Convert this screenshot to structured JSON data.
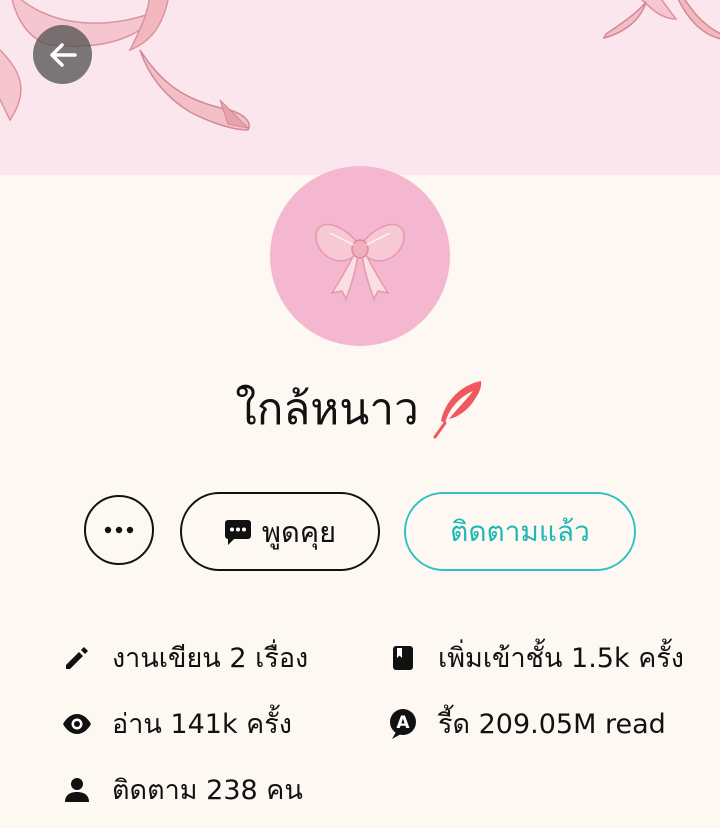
{
  "profile": {
    "name": "ใกล้หนาว"
  },
  "actions": {
    "more_label": "•••",
    "chat_label": "พูดคุย",
    "follow_label": "ติดตามแล้ว"
  },
  "stats": {
    "works": "งานเขียน 2 เรื่อง",
    "library": "เพิ่มเข้าชั้น 1.5k ครั้ง",
    "reads": "อ่าน 141k ครั้ง",
    "reads_total": "รี้ด 209.05M read",
    "followers": "ติดตาม 238 คน"
  },
  "icons": {
    "back": "arrow-left-icon",
    "feather": "feather-icon",
    "more": "more-dots-icon",
    "chat": "chat-bubble-icon",
    "works": "pencil-icon",
    "library": "book-icon",
    "reads": "eye-icon",
    "reads_total": "a-badge-icon",
    "followers": "person-icon"
  },
  "colors": {
    "banner": "#fce6ee",
    "background": "#fdf8f2",
    "avatar": "#f4b7cf",
    "accent": "#2ec4c4",
    "feather": "#f0575f"
  }
}
